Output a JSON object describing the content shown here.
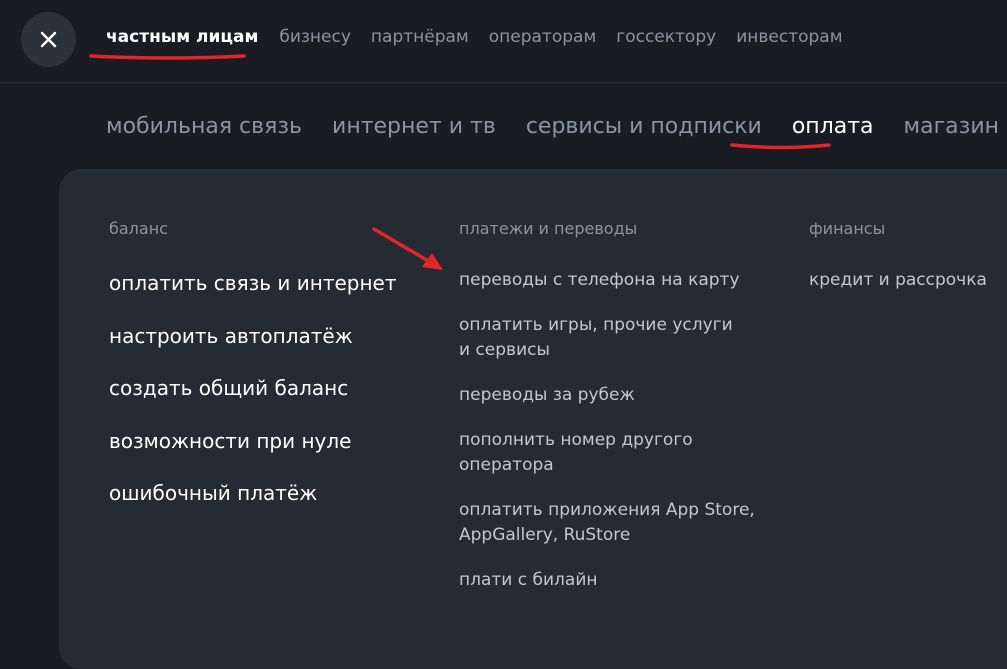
{
  "segments": [
    "частным лицам",
    "бизнесу",
    "партнёрам",
    "операторам",
    "госсектору",
    "инвесторам"
  ],
  "categories": [
    "мобильная связь",
    "интернет и тв",
    "сервисы и подписки",
    "оплата",
    "магазин"
  ],
  "columns": {
    "balance": {
      "title": "баланс",
      "links": [
        "оплатить связь и интернет",
        "настроить автоплатёж",
        "создать общий баланс",
        "возможности при нуле",
        "ошибочный платёж"
      ]
    },
    "payments": {
      "title": "платежи и переводы",
      "links": [
        "переводы с телефона на карту",
        "оплатить игры, прочие услуги и сервисы",
        "переводы за рубеж",
        "пополнить номер другого оператора",
        "оплатить приложения App Store, AppGallery, RuStore",
        "плати с билайн"
      ]
    },
    "finance": {
      "title": "финансы",
      "links": [
        "кредит и рассрочка"
      ]
    }
  },
  "icons": {
    "close": "close-icon"
  },
  "colors": {
    "background": "#191c22",
    "panel": "#262a33",
    "annotation": "#e3242b",
    "muted": "#8d939f"
  }
}
